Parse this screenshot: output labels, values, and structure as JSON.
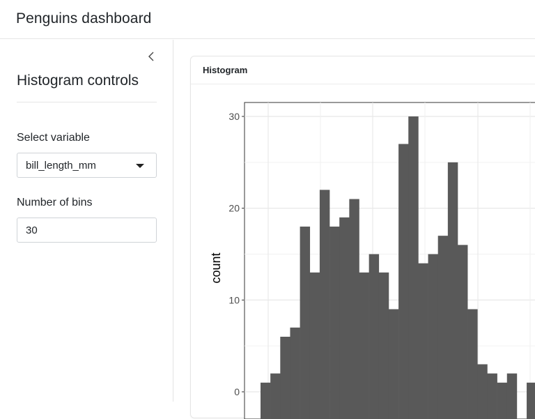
{
  "header": {
    "title": "Penguins dashboard"
  },
  "sidebar": {
    "collapse_icon": "chevron-left-icon",
    "title": "Histogram controls",
    "variable_label": "Select variable",
    "variable_value": "bill_length_mm",
    "bins_label": "Number of bins",
    "bins_value": "30"
  },
  "card": {
    "title": "Histogram"
  },
  "chart_data": {
    "type": "bar",
    "title": "",
    "xlabel": "",
    "ylabel": "count",
    "ylim": [
      0,
      30
    ],
    "yticks": [
      0,
      10,
      20,
      30
    ],
    "grid": true,
    "bar_color": "#595959",
    "panel_border": "#333333",
    "values": [
      1,
      2,
      6,
      7,
      18,
      13,
      22,
      18,
      19,
      21,
      13,
      15,
      13,
      9,
      27,
      30,
      14,
      15,
      17,
      25,
      16,
      9,
      3,
      2,
      1,
      2,
      0,
      1
    ]
  }
}
